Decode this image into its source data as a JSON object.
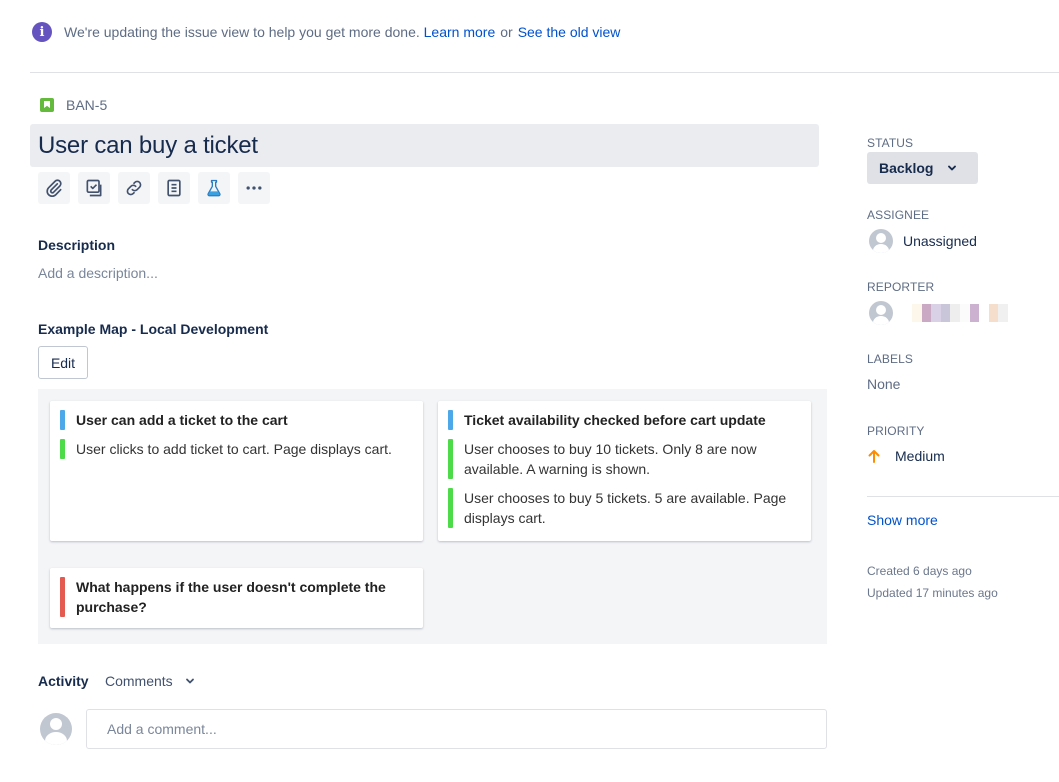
{
  "banner": {
    "icon": "info-icon",
    "text": "We're updating the issue view to help you get more done.",
    "learn_more": "Learn more",
    "or": "or",
    "old_view": "See the old view"
  },
  "issue": {
    "key": "BAN-5",
    "title": "User can buy a ticket"
  },
  "toolbar": {
    "icons": [
      "attachment-icon",
      "subtask-icon",
      "link-icon",
      "page-icon",
      "lab-flask-icon",
      "more-icon"
    ]
  },
  "description": {
    "label": "Description",
    "placeholder": "Add a description..."
  },
  "example_map": {
    "label": "Example Map - Local Development",
    "edit_label": "Edit",
    "cards": [
      {
        "rule": "User can add a ticket to the cart",
        "examples": [
          "User clicks to add ticket to cart. Page displays cart."
        ]
      },
      {
        "rule": "Ticket availability checked before cart update",
        "examples": [
          "User chooses to buy 10 tickets. Only 8 are now available. A warning is shown.",
          "User chooses to buy 5 tickets. 5 are available. Page displays cart."
        ]
      },
      {
        "question": "What happens if the user doesn't complete the purchase?"
      }
    ]
  },
  "activity": {
    "label": "Activity",
    "filter": "Comments",
    "comment_placeholder": "Add a comment..."
  },
  "sidebar": {
    "status_label": "STATUS",
    "status_value": "Backlog",
    "assignee_label": "ASSIGNEE",
    "assignee_value": "Unassigned",
    "reporter_label": "REPORTER",
    "labels_label": "LABELS",
    "labels_value": "None",
    "priority_label": "PRIORITY",
    "priority_value": "Medium",
    "show_more": "Show more",
    "created": "Created 6 days ago",
    "updated": "Updated 17 minutes ago"
  },
  "colors": {
    "rule_bar": "#4ca8e8",
    "example_bar": "#4ddb4a",
    "question_bar": "#e45a50",
    "link": "#0052cc",
    "priority_medium": "#ff8b00"
  }
}
